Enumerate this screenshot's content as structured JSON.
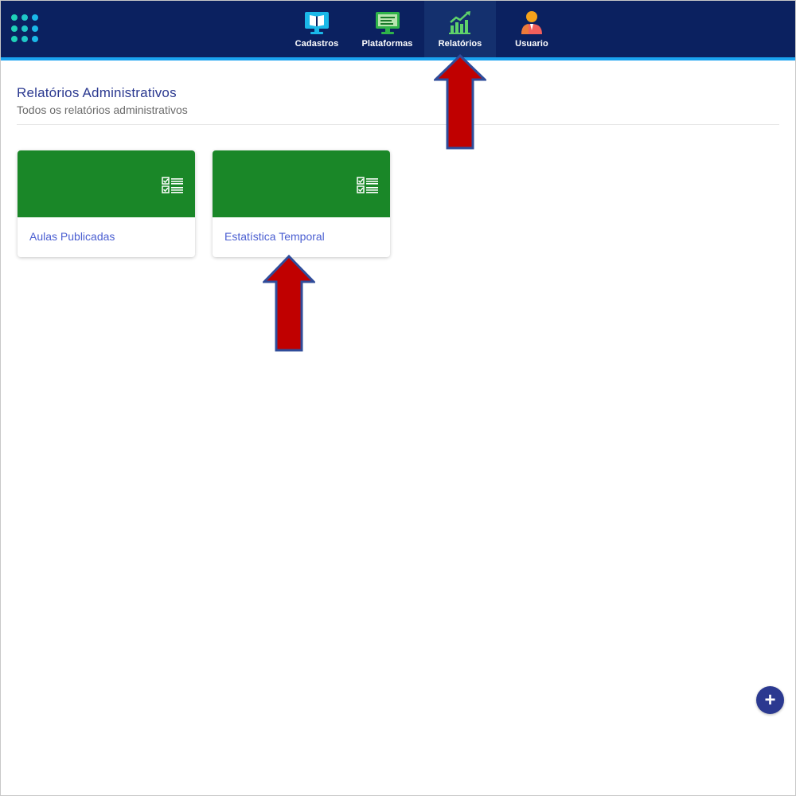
{
  "colors": {
    "topbar": "#0b2160",
    "accent": "#1aa3f0",
    "card_header": "#1a8728",
    "title": "#2b3990",
    "link": "#4a5ed1",
    "arrow_fill": "#c00000",
    "arrow_stroke": "#2f4c9a"
  },
  "nav": {
    "items": [
      {
        "label": "Cadastros",
        "icon": "monitor-book-icon"
      },
      {
        "label": "Plataformas",
        "icon": "monitor-list-icon"
      },
      {
        "label": "Relatórios",
        "icon": "bar-chart-trend-icon",
        "active": true
      },
      {
        "label": "Usuario",
        "icon": "user-icon"
      }
    ]
  },
  "header": {
    "title": "Relatórios Administrativos",
    "subtitle": "Todos os relatórios administrativos"
  },
  "cards": [
    {
      "label": "Aulas Publicadas",
      "icon": "checklist-icon"
    },
    {
      "label": "Estatística Temporal",
      "icon": "checklist-icon"
    }
  ],
  "fab": {
    "label": "+",
    "icon": "plus-icon"
  }
}
